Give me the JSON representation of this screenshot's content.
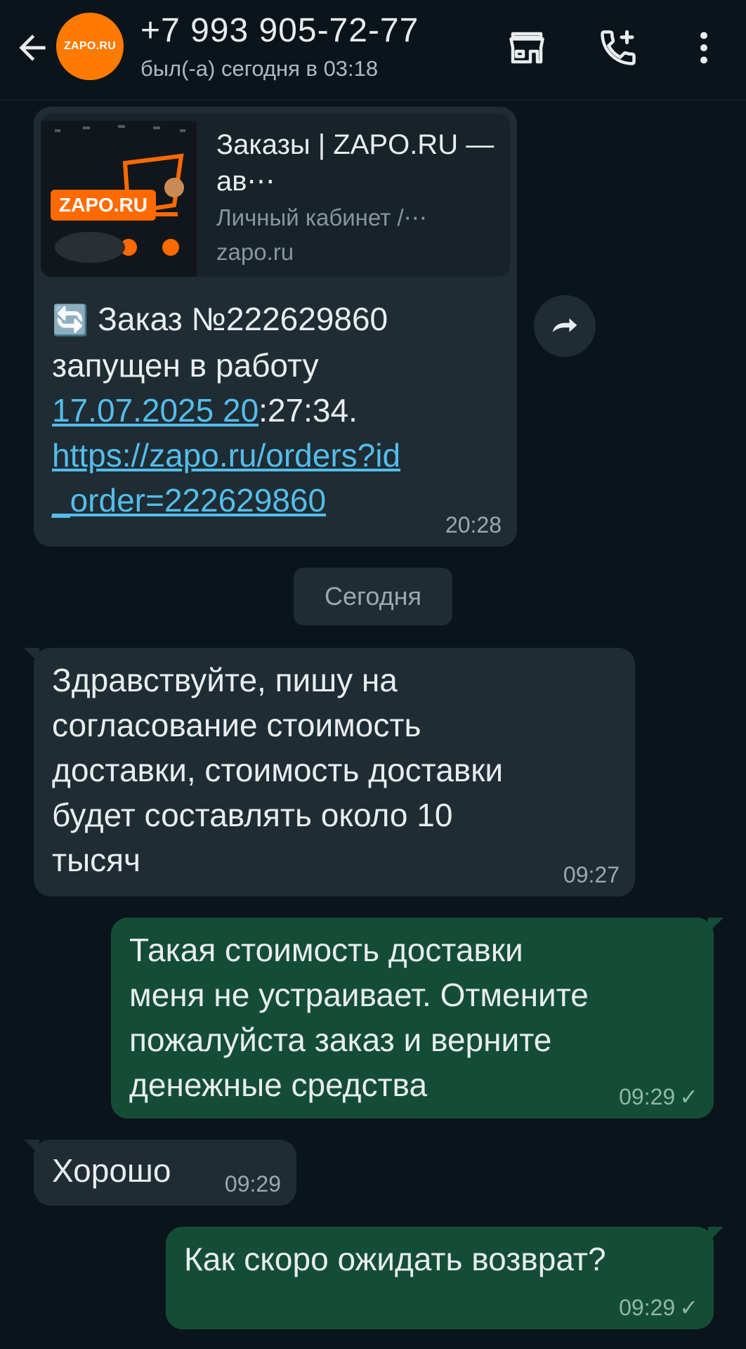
{
  "header": {
    "contact_name": "+7 993 905-72-77",
    "status": "был(-а) сегодня в 03:18",
    "avatar_label": "ZAPO.RU"
  },
  "messages": [
    {
      "direction": "in",
      "preview": {
        "thumb_logo": "ZAPO.RU",
        "title": "Заказы | ZAPO.RU — ав⋯",
        "description": "Личный кабинет /⋯",
        "domain": "zapo.ru"
      },
      "emoji": "🔄",
      "text_part1": "Заказ №222629860\nзапущен в работу\n",
      "link_date": "17.07.2025 20",
      "text_part2": ":27:34.\n",
      "link_url": "https://zapo.ru/orders?id\n_order=222629860",
      "time": "20:28"
    },
    {
      "direction": "in",
      "text": "Здравствуйте, пишу на\nсогласование стоимость\nдоставки, стоимость доставки\nбудет составлять около 10\nтысяч",
      "time": "09:27"
    },
    {
      "direction": "out",
      "text": "Такая стоимость доставки\nменя не устраивает. Отмените\nпожалуйста заказ и верните\nденежные средства",
      "time": "09:29",
      "status": "✓"
    },
    {
      "direction": "in",
      "text": "Хорошо",
      "time": "09:29"
    },
    {
      "direction": "out",
      "text": "Как скоро ожидать возврат?",
      "time": "09:29",
      "status": "✓"
    }
  ],
  "date_separator": "Сегодня",
  "colors": {
    "background": "#0b141a",
    "incoming_bubble": "#1f2c33",
    "outgoing_bubble": "#144d37",
    "link": "#53bdeb",
    "avatar": "#ff7a00"
  }
}
